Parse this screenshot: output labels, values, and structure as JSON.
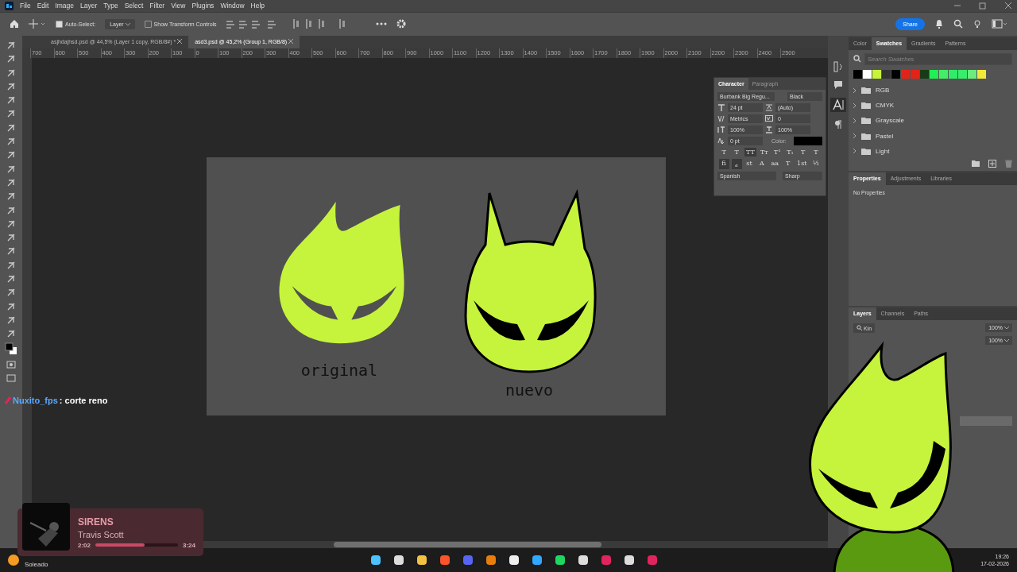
{
  "menu": [
    "File",
    "Edit",
    "Image",
    "Layer",
    "Type",
    "Select",
    "Filter",
    "View",
    "Plugins",
    "Window",
    "Help"
  ],
  "options_bar": {
    "auto_select": {
      "label": "Auto-Select:",
      "checked": true
    },
    "target": "Layer",
    "transform_controls": {
      "label": "Show Transform Controls",
      "checked": false
    },
    "share": "Share"
  },
  "doc_tabs": [
    {
      "label": "asjhdajhsd.psd @ 44,5% (Layer 1 copy, RGB/8#) *",
      "selected": false
    },
    {
      "label": "asd3.psd @ 45,2% (Group 1, RGB/8)",
      "selected": true
    }
  ],
  "ruler": [
    "700",
    "600",
    "500",
    "400",
    "300",
    "200",
    "100",
    "0",
    "100",
    "200",
    "300",
    "400",
    "500",
    "600",
    "700",
    "800",
    "900",
    "1000",
    "1100",
    "1200",
    "1300",
    "1400",
    "1500",
    "1600",
    "1700",
    "1800",
    "1900",
    "2000",
    "2100",
    "2200",
    "2300",
    "2400",
    "2500"
  ],
  "document": {
    "labels": [
      "original",
      "nuevo"
    ]
  },
  "character": {
    "tabs": [
      {
        "label": "Character",
        "selected": true
      },
      {
        "label": "Paragraph",
        "selected": false
      }
    ],
    "font": "Burbank Big Regu...",
    "style": "Black",
    "size": "24 pt",
    "leading": "(Auto)",
    "kerning": "Metrics",
    "tracking": "0",
    "vscale": "100%",
    "hscale": "100%",
    "baseline": "0 pt",
    "color_label": "Color:",
    "color": "#000000",
    "styles": [
      {
        "glyph": "T",
        "selected": false
      },
      {
        "glyph": "T",
        "selected": false
      },
      {
        "glyph": "TT",
        "selected": true
      },
      {
        "glyph": "Tт",
        "selected": false
      },
      {
        "glyph": "T¹",
        "selected": false
      },
      {
        "glyph": "T₁",
        "selected": false
      },
      {
        "glyph": "T",
        "selected": false
      },
      {
        "glyph": "T",
        "selected": false
      }
    ],
    "features": [
      {
        "glyph": "fi",
        "selected": true
      },
      {
        "glyph": "ℴ",
        "selected": true
      },
      {
        "glyph": "st",
        "selected": false
      },
      {
        "glyph": "A",
        "selected": false
      },
      {
        "glyph": "aa",
        "selected": false
      },
      {
        "glyph": "T",
        "selected": false
      },
      {
        "glyph": "1st",
        "selected": false
      },
      {
        "glyph": "½",
        "selected": false
      }
    ],
    "language": "Spanish",
    "antialias": "Sharp"
  },
  "swatches": {
    "tabs": [
      {
        "label": "Color",
        "selected": false
      },
      {
        "label": "Swatches",
        "selected": true
      },
      {
        "label": "Gradients",
        "selected": false
      },
      {
        "label": "Patterns",
        "selected": false
      }
    ],
    "search": {
      "placeholder": "Search Swatches"
    },
    "colors": [
      {
        "color": "#000000"
      },
      {
        "color": "#ffffff"
      },
      {
        "color": "#c6f43c"
      },
      {
        "color": "#333333"
      },
      {
        "color": "#000000"
      },
      {
        "color": "#e2231a"
      },
      {
        "color": "#e2231a"
      },
      {
        "color": "#173b17"
      },
      {
        "color": "#22ee55"
      },
      {
        "color": "#44ee66"
      },
      {
        "color": "#30ec68"
      },
      {
        "color": "#3aec6c"
      },
      {
        "color": "#6cec7c"
      },
      {
        "color": "#f2e83a"
      }
    ],
    "folders": [
      "RGB",
      "CMYK",
      "Grayscale",
      "Pastel",
      "Light"
    ]
  },
  "properties": {
    "tabs": [
      {
        "label": "Properties",
        "selected": true
      },
      {
        "label": "Adjustments",
        "selected": false
      },
      {
        "label": "Libraries",
        "selected": false
      }
    ],
    "text": "No Properties"
  },
  "layers": {
    "tabs": [
      {
        "label": "Layers",
        "selected": true
      },
      {
        "label": "Channels",
        "selected": false
      },
      {
        "label": "Paths",
        "selected": false
      }
    ],
    "filter": "Kin",
    "opacity": "100%",
    "fill": "100%"
  },
  "chat": {
    "user": "Nuxito_fps",
    "message": ": corte reno"
  },
  "music": {
    "title": "SIRENS",
    "artist": "Travis Scott",
    "elapsed": "2:02",
    "total": "3:24",
    "level": 0.6
  },
  "taskbar": {
    "weather": "Soleado",
    "time": "19:26",
    "date": "17-02-2026"
  }
}
